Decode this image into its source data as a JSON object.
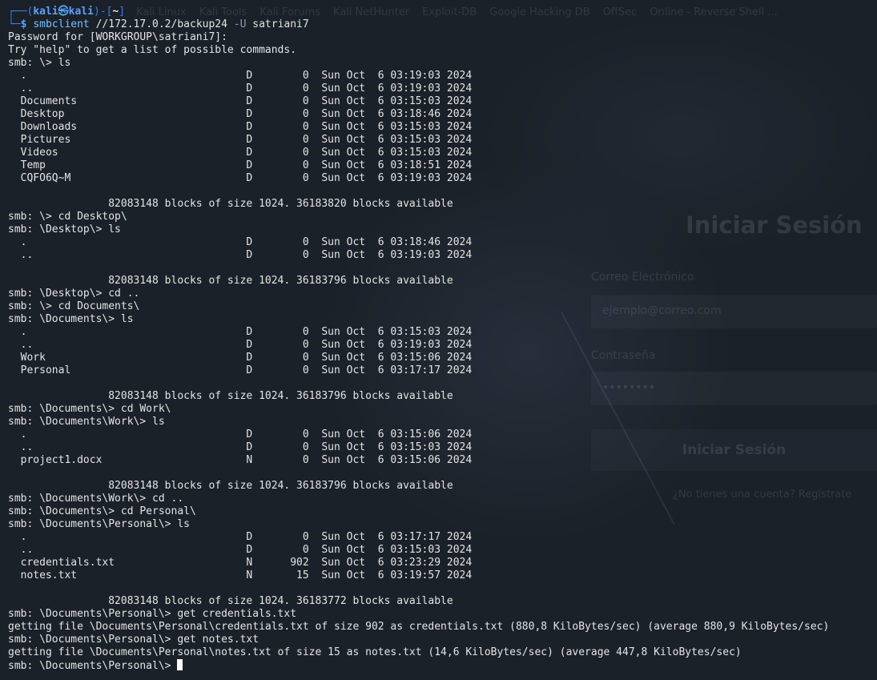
{
  "background": {
    "bookmarks": [
      "Kali Linux",
      "Kali Tools",
      "Kali Forums",
      "Kali NetHunter",
      "Exploit-DB",
      "Google Hacking DB",
      "OffSec",
      "Online - Reverse Shell ..."
    ],
    "login": {
      "title": "Iniciar Sesión",
      "email_label": "Correo Electrónico",
      "email_placeholder": "ejemplo@correo.com",
      "password_label": "Contraseña",
      "password_placeholder": "••••••••",
      "button": "Iniciar Sesión",
      "footer": "¿No tienes una cuenta? Regístrate"
    }
  },
  "prompt": {
    "open": "┌──(",
    "user_host": "kali㉿kali",
    "mid": ")-[",
    "dir": "~",
    "close": "]",
    "bottom": "└─",
    "dollar": "$",
    "cmd_name": "smbclient",
    "cmd_args": " //172.17.0.2/backup24 ",
    "cmd_flag": "-U",
    "cmd_user": " satriani7"
  },
  "lines": [
    "Password for [WORKGROUP\\satriani7]:",
    "Try \"help\" to get a list of possible commands.",
    "smb: \\> ls",
    "  .                                   D        0  Sun Oct  6 03:19:03 2024",
    "  ..                                  D        0  Sun Oct  6 03:19:03 2024",
    "  Documents                           D        0  Sun Oct  6 03:15:03 2024",
    "  Desktop                             D        0  Sun Oct  6 03:18:46 2024",
    "  Downloads                           D        0  Sun Oct  6 03:15:03 2024",
    "  Pictures                            D        0  Sun Oct  6 03:15:03 2024",
    "  Videos                              D        0  Sun Oct  6 03:15:03 2024",
    "  Temp                                D        0  Sun Oct  6 03:18:51 2024",
    "  CQFO6Q~M                            D        0  Sun Oct  6 03:19:03 2024",
    "",
    "                82083148 blocks of size 1024. 36183820 blocks available",
    "smb: \\> cd Desktop\\",
    "smb: \\Desktop\\> ls",
    "  .                                   D        0  Sun Oct  6 03:18:46 2024",
    "  ..                                  D        0  Sun Oct  6 03:19:03 2024",
    "",
    "                82083148 blocks of size 1024. 36183796 blocks available",
    "smb: \\Desktop\\> cd ..",
    "smb: \\> cd Documents\\",
    "smb: \\Documents\\> ls",
    "  .                                   D        0  Sun Oct  6 03:15:03 2024",
    "  ..                                  D        0  Sun Oct  6 03:19:03 2024",
    "  Work                                D        0  Sun Oct  6 03:15:06 2024",
    "  Personal                            D        0  Sun Oct  6 03:17:17 2024",
    "",
    "                82083148 blocks of size 1024. 36183796 blocks available",
    "smb: \\Documents\\> cd Work\\",
    "smb: \\Documents\\Work\\> ls",
    "  .                                   D        0  Sun Oct  6 03:15:06 2024",
    "  ..                                  D        0  Sun Oct  6 03:15:03 2024",
    "  project1.docx                       N        0  Sun Oct  6 03:15:06 2024",
    "",
    "                82083148 blocks of size 1024. 36183796 blocks available",
    "smb: \\Documents\\Work\\> cd ..",
    "smb: \\Documents\\> cd Personal\\",
    "smb: \\Documents\\Personal\\> ls",
    "  .                                   D        0  Sun Oct  6 03:17:17 2024",
    "  ..                                  D        0  Sun Oct  6 03:15:03 2024",
    "  credentials.txt                     N      902  Sun Oct  6 03:23:29 2024",
    "  notes.txt                           N       15  Sun Oct  6 03:19:57 2024",
    "",
    "                82083148 blocks of size 1024. 36183772 blocks available",
    "smb: \\Documents\\Personal\\> get credentials.txt",
    "getting file \\Documents\\Personal\\credentials.txt of size 902 as credentials.txt (880,8 KiloBytes/sec) (average 880,9 KiloBytes/sec)",
    "smb: \\Documents\\Personal\\> get notes.txt",
    "getting file \\Documents\\Personal\\notes.txt of size 15 as notes.txt (14,6 KiloBytes/sec) (average 447,8 KiloBytes/sec)",
    "smb: \\Documents\\Personal\\> "
  ],
  "colors": {
    "terminal_bg": "#1b2129",
    "text": "#e4e4e4",
    "prompt_accent": "#5aa0ff"
  }
}
